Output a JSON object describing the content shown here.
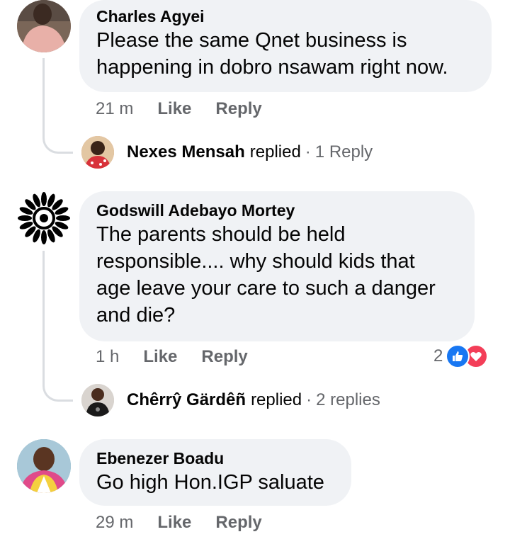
{
  "comments": [
    {
      "author": "Charles Agyei",
      "text_lines": [
        "Please the same Qnet business is",
        "happening in dobro nsawam right now."
      ],
      "time": "21 m",
      "like_label": "Like",
      "reply_label": "Reply",
      "reply_summary": {
        "name": "Nexes Mensah",
        "verb": "replied",
        "dot": "·",
        "count": "1 Reply"
      }
    },
    {
      "author": "Godswill Adebayo Mortey",
      "text_lines": [
        "The parents should be held",
        "responsible.... why should kids that",
        "age leave your care to such a danger",
        "and die?"
      ],
      "time": "1 h",
      "like_label": "Like",
      "reply_label": "Reply",
      "reaction_count": "2",
      "reactions": [
        "like-icon",
        "love-icon"
      ],
      "reply_summary": {
        "name": "Chêrrŷ Gärdêñ",
        "verb": "replied",
        "dot": "·",
        "count": "2 replies"
      }
    },
    {
      "author": "Ebenezer Boadu",
      "text_lines": [
        "Go high Hon.IGP saluate"
      ],
      "time": "29 m",
      "like_label": "Like",
      "reply_label": "Reply"
    }
  ],
  "colors": {
    "bubble": "#f0f2f5",
    "secondary_text": "#65676b",
    "like_blue": "#1877f2",
    "love_red": "#f33e58",
    "thread_line": "#dadde1"
  }
}
